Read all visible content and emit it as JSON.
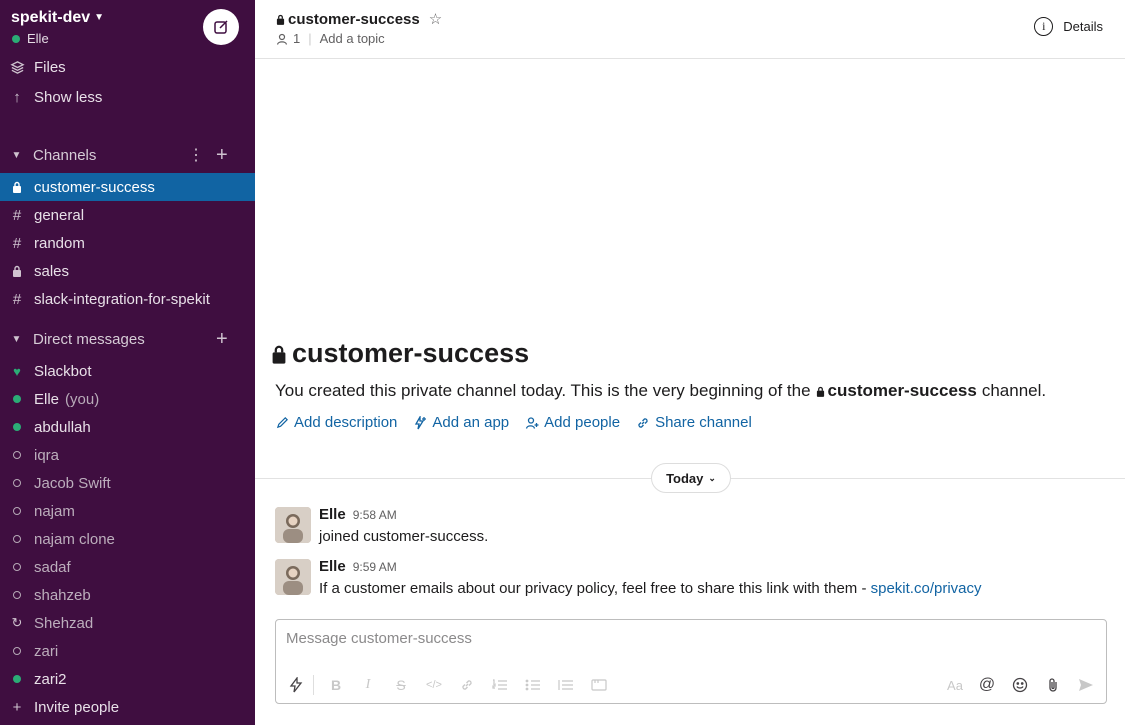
{
  "workspace": {
    "name": "spekit-dev",
    "user": "Elle"
  },
  "sidebar": {
    "nav": [
      {
        "label": "Files",
        "icon": "layers-icon"
      },
      {
        "label": "Show less",
        "icon": "arrow-up-icon"
      }
    ],
    "channels_heading": "Channels",
    "channels": [
      {
        "name": "customer-success",
        "private": true,
        "active": true
      },
      {
        "name": "general",
        "private": false
      },
      {
        "name": "random",
        "private": false
      },
      {
        "name": "sales",
        "private": true
      },
      {
        "name": "slack-integration-for-spekit",
        "private": false
      }
    ],
    "dm_heading": "Direct messages",
    "dms": [
      {
        "name": "Slackbot",
        "status": "heart",
        "online": true
      },
      {
        "name": "Elle",
        "status": "online",
        "online": true,
        "tag": "(you)"
      },
      {
        "name": "abdullah",
        "status": "online",
        "online": true
      },
      {
        "name": "iqra",
        "status": "offline",
        "online": false
      },
      {
        "name": "Jacob Swift",
        "status": "offline",
        "online": false
      },
      {
        "name": "najam",
        "status": "offline",
        "online": false
      },
      {
        "name": "najam clone",
        "status": "offline",
        "online": false
      },
      {
        "name": "sadaf",
        "status": "offline",
        "online": false
      },
      {
        "name": "shahzeb",
        "status": "offline",
        "online": false
      },
      {
        "name": "Shehzad",
        "status": "offline",
        "online": false
      },
      {
        "name": "zari",
        "status": "offline",
        "online": false
      },
      {
        "name": "zari2",
        "status": "online",
        "online": true
      }
    ],
    "invite_label": "Invite people"
  },
  "header": {
    "channel": "customer-success",
    "members": "1",
    "topic": "Add a topic",
    "details": "Details"
  },
  "intro": {
    "title": "customer-success",
    "text_before": "You created this private channel today. This is the very beginning of the",
    "channel": "customer-success",
    "text_after": "channel.",
    "actions": {
      "description": "Add description",
      "app": "Add an app",
      "people": "Add people",
      "share": "Share channel"
    }
  },
  "divider_label": "Today",
  "messages": [
    {
      "author": "Elle",
      "time": "9:58 AM",
      "text": "joined customer-success.",
      "link": ""
    },
    {
      "author": "Elle",
      "time": "9:59 AM",
      "text": "If a customer emails about our privacy policy, feel free to share this link with them -",
      "link": "spekit.co/privacy"
    }
  ],
  "composer": {
    "placeholder": "Message customer-success",
    "value": "",
    "format_label": "Aa"
  },
  "colors": {
    "sidebar": "#3f0e40",
    "active": "#1164a3",
    "online": "#2bac76",
    "link": "#1264a3"
  }
}
